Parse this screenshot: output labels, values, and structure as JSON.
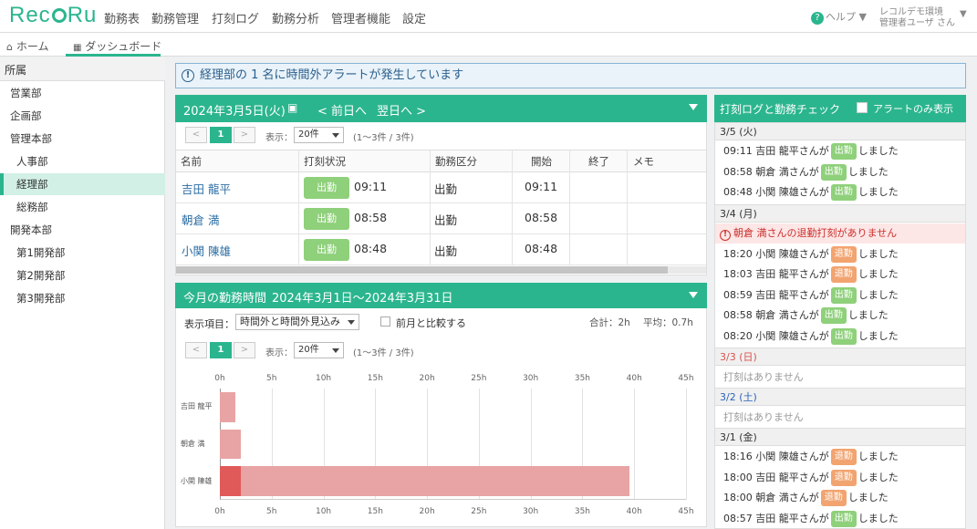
{
  "app": {
    "logo_left": "Rec",
    "logo_right": "Ru",
    "nav": [
      "勤務表",
      "勤務管理",
      "打刻ログ",
      "勤務分析",
      "管理者機能",
      "設定"
    ],
    "help_label": "ヘルプ",
    "env_label": "レコルデモ環境",
    "user_label": "管理者ユーザ さん"
  },
  "tabs": [
    {
      "label": "ホーム"
    },
    {
      "label": "ダッシュボード"
    }
  ],
  "sidebar": {
    "header": "所属",
    "items": [
      "営業部",
      "企画部",
      "管理本部",
      "人事部",
      "経理部",
      "総務部",
      "開発本部",
      "第1開発部",
      "第2開発部",
      "第3開発部"
    ],
    "selected": "経理部"
  },
  "alert": {
    "message": "経理部の 1 名に時間外アラートが発生しています"
  },
  "daily": {
    "date": "2024年3月5日(火)",
    "prev": "< 前日へ",
    "next": "翌日へ >",
    "page": "1",
    "display_label": "表示：",
    "per_page": "20件",
    "range": "(1～3件 / 3件)",
    "columns": [
      "名前",
      "打刻状況",
      "勤務区分",
      "開始",
      "終了",
      "メモ"
    ],
    "rows": [
      {
        "name": "吉田 龍平",
        "status": "出勤",
        "status_time": "09:11",
        "type": "出勤",
        "start": "09:11",
        "end": "",
        "memo": ""
      },
      {
        "name": "朝倉 満",
        "status": "出勤",
        "status_time": "08:58",
        "type": "出勤",
        "start": "08:58",
        "end": "",
        "memo": ""
      },
      {
        "name": "小関 陳雄",
        "status": "出勤",
        "status_time": "08:48",
        "type": "出勤",
        "start": "08:48",
        "end": "",
        "memo": ""
      }
    ]
  },
  "monthly": {
    "title": "今月の勤務時間",
    "period": "2024年3月1日～2024年3月31日",
    "display_item_label": "表示項目：",
    "display_item": "時間外と時間外見込み",
    "compare_label": "前月と比較する",
    "total": "合計：2h",
    "average": "平均：0.7h",
    "page": "1",
    "display_label": "表示：",
    "per_page": "20件",
    "range": "(1～3件 / 3件)"
  },
  "chart_data": {
    "type": "bar",
    "orientation": "horizontal",
    "stacked": true,
    "categories": [
      "吉田 龍平",
      "朝倉 満",
      "小関 陳雄"
    ],
    "series": [
      {
        "values": [
          0,
          0,
          2
        ],
        "color": "#e05a5a"
      },
      {
        "values": [
          1.5,
          2,
          37.5
        ],
        "color": "#e8a4a4"
      }
    ],
    "x_ticks": [
      "0h",
      "5h",
      "10h",
      "15h",
      "20h",
      "25h",
      "30h",
      "35h",
      "40h",
      "45h"
    ],
    "xlim": [
      0,
      45
    ],
    "grid": true
  },
  "log": {
    "title": "打刻ログと勤務チェック",
    "alert_only_label": "アラートのみ表示",
    "days": [
      {
        "date": "3/5 (火)",
        "color": "#333",
        "entries": [
          {
            "time": "09:11",
            "name": "吉田 龍平さんが",
            "badge": "出勤",
            "kind": "in",
            "suffix": "しました"
          },
          {
            "time": "08:58",
            "name": "朝倉 満さんが",
            "badge": "出勤",
            "kind": "in",
            "suffix": "しました"
          },
          {
            "time": "08:48",
            "name": "小関 陳雄さんが",
            "badge": "出勤",
            "kind": "in",
            "suffix": "しました"
          }
        ]
      },
      {
        "date": "3/4 (月)",
        "color": "#333",
        "warning": "朝倉 満さんの退勤打刻がありません",
        "entries": [
          {
            "time": "18:20",
            "name": "小関 陳雄さんが",
            "badge": "退勤",
            "kind": "out",
            "suffix": "しました"
          },
          {
            "time": "18:03",
            "name": "吉田 龍平さんが",
            "badge": "退勤",
            "kind": "out",
            "suffix": "しました"
          },
          {
            "time": "08:59",
            "name": "吉田 龍平さんが",
            "badge": "出勤",
            "kind": "in",
            "suffix": "しました"
          },
          {
            "time": "08:58",
            "name": "朝倉 満さんが",
            "badge": "出勤",
            "kind": "in",
            "suffix": "しました"
          },
          {
            "time": "08:20",
            "name": "小関 陳雄さんが",
            "badge": "出勤",
            "kind": "in",
            "suffix": "しました"
          }
        ]
      },
      {
        "date": "3/3 (日)",
        "color": "#d9534f",
        "empty": "打刻はありません",
        "entries": []
      },
      {
        "date": "3/2 (土)",
        "color": "#2a62b8",
        "empty": "打刻はありません",
        "entries": []
      },
      {
        "date": "3/1 (金)",
        "color": "#333",
        "entries": [
          {
            "time": "18:16",
            "name": "小関 陳雄さんが",
            "badge": "退勤",
            "kind": "out",
            "suffix": "しました"
          },
          {
            "time": "18:00",
            "name": "吉田 龍平さんが",
            "badge": "退勤",
            "kind": "out",
            "suffix": "しました"
          },
          {
            "time": "18:00",
            "name": "朝倉 満さんが",
            "badge": "退勤",
            "kind": "out",
            "suffix": "しました"
          },
          {
            "time": "08:57",
            "name": "吉田 龍平さんが",
            "badge": "出勤",
            "kind": "in",
            "suffix": "しました"
          }
        ]
      }
    ]
  }
}
